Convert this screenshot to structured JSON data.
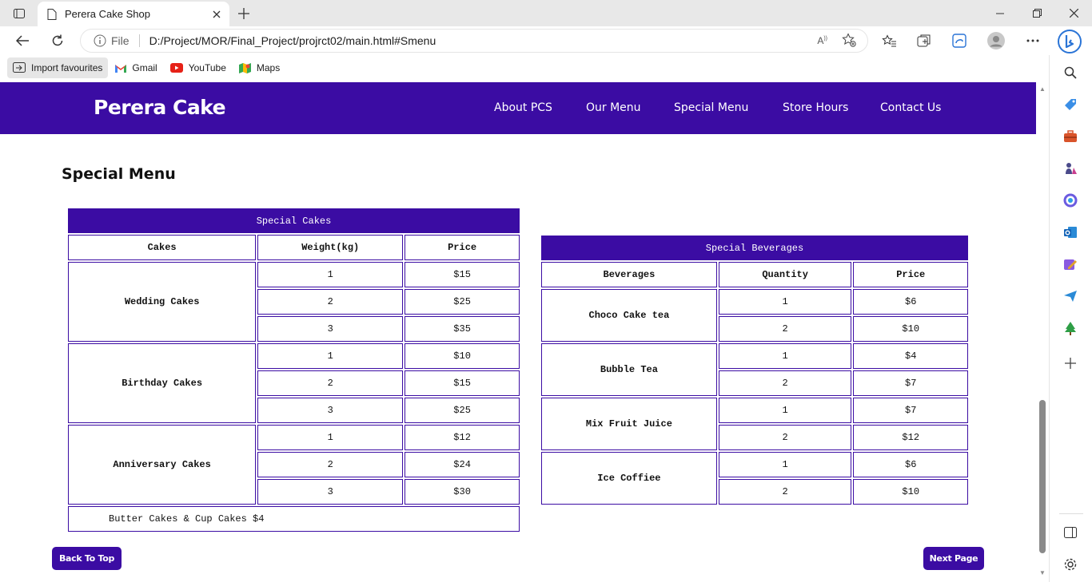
{
  "browser": {
    "tab_title": "Perera Cake Shop",
    "address_file_label": "File",
    "address_url": "D:/Project/MOR/Final_Project/projrct02/main.html#Smenu",
    "favourites": [
      {
        "label": "Import favourites",
        "icon": "import-icon"
      },
      {
        "label": "Gmail",
        "icon": "gmail-icon"
      },
      {
        "label": "YouTube",
        "icon": "youtube-icon"
      },
      {
        "label": "Maps",
        "icon": "maps-icon"
      }
    ]
  },
  "site": {
    "brand": "Perera Cake",
    "brand_color": "#3b0ca3",
    "nav": [
      "About PCS",
      "Our Menu",
      "Special Menu",
      "Store Hours",
      "Contact Us"
    ],
    "section_title": "Special Menu",
    "back_to_top": "Back To Top",
    "next_page": "Next Page"
  },
  "cakes_table": {
    "caption": "Special Cakes",
    "headers": [
      "Cakes",
      "Weight(kg)",
      "Price"
    ],
    "groups": [
      {
        "name": "Wedding Cakes",
        "rows": [
          [
            "1",
            "$15"
          ],
          [
            "2",
            "$25"
          ],
          [
            "3",
            "$35"
          ]
        ]
      },
      {
        "name": "Birthday Cakes",
        "rows": [
          [
            "1",
            "$10"
          ],
          [
            "2",
            "$15"
          ],
          [
            "3",
            "$25"
          ]
        ]
      },
      {
        "name": "Anniversary Cakes",
        "rows": [
          [
            "1",
            "$12"
          ],
          [
            "2",
            "$24"
          ],
          [
            "3",
            "$30"
          ]
        ]
      }
    ],
    "note": "Butter Cakes & Cup Cakes $4"
  },
  "beverages_table": {
    "caption": "Special Beverages",
    "headers": [
      "Beverages",
      "Quantity",
      "Price"
    ],
    "groups": [
      {
        "name": "Choco Cake tea",
        "rows": [
          [
            "1",
            "$6"
          ],
          [
            "2",
            "$10"
          ]
        ]
      },
      {
        "name": "Bubble Tea",
        "rows": [
          [
            "1",
            "$4"
          ],
          [
            "2",
            "$7"
          ]
        ]
      },
      {
        "name": "Mix Fruit Juice",
        "rows": [
          [
            "1",
            "$7"
          ],
          [
            "2",
            "$12"
          ]
        ]
      },
      {
        "name": "Ice Coffiee",
        "rows": [
          [
            "1",
            "$6"
          ],
          [
            "2",
            "$10"
          ]
        ]
      }
    ]
  }
}
